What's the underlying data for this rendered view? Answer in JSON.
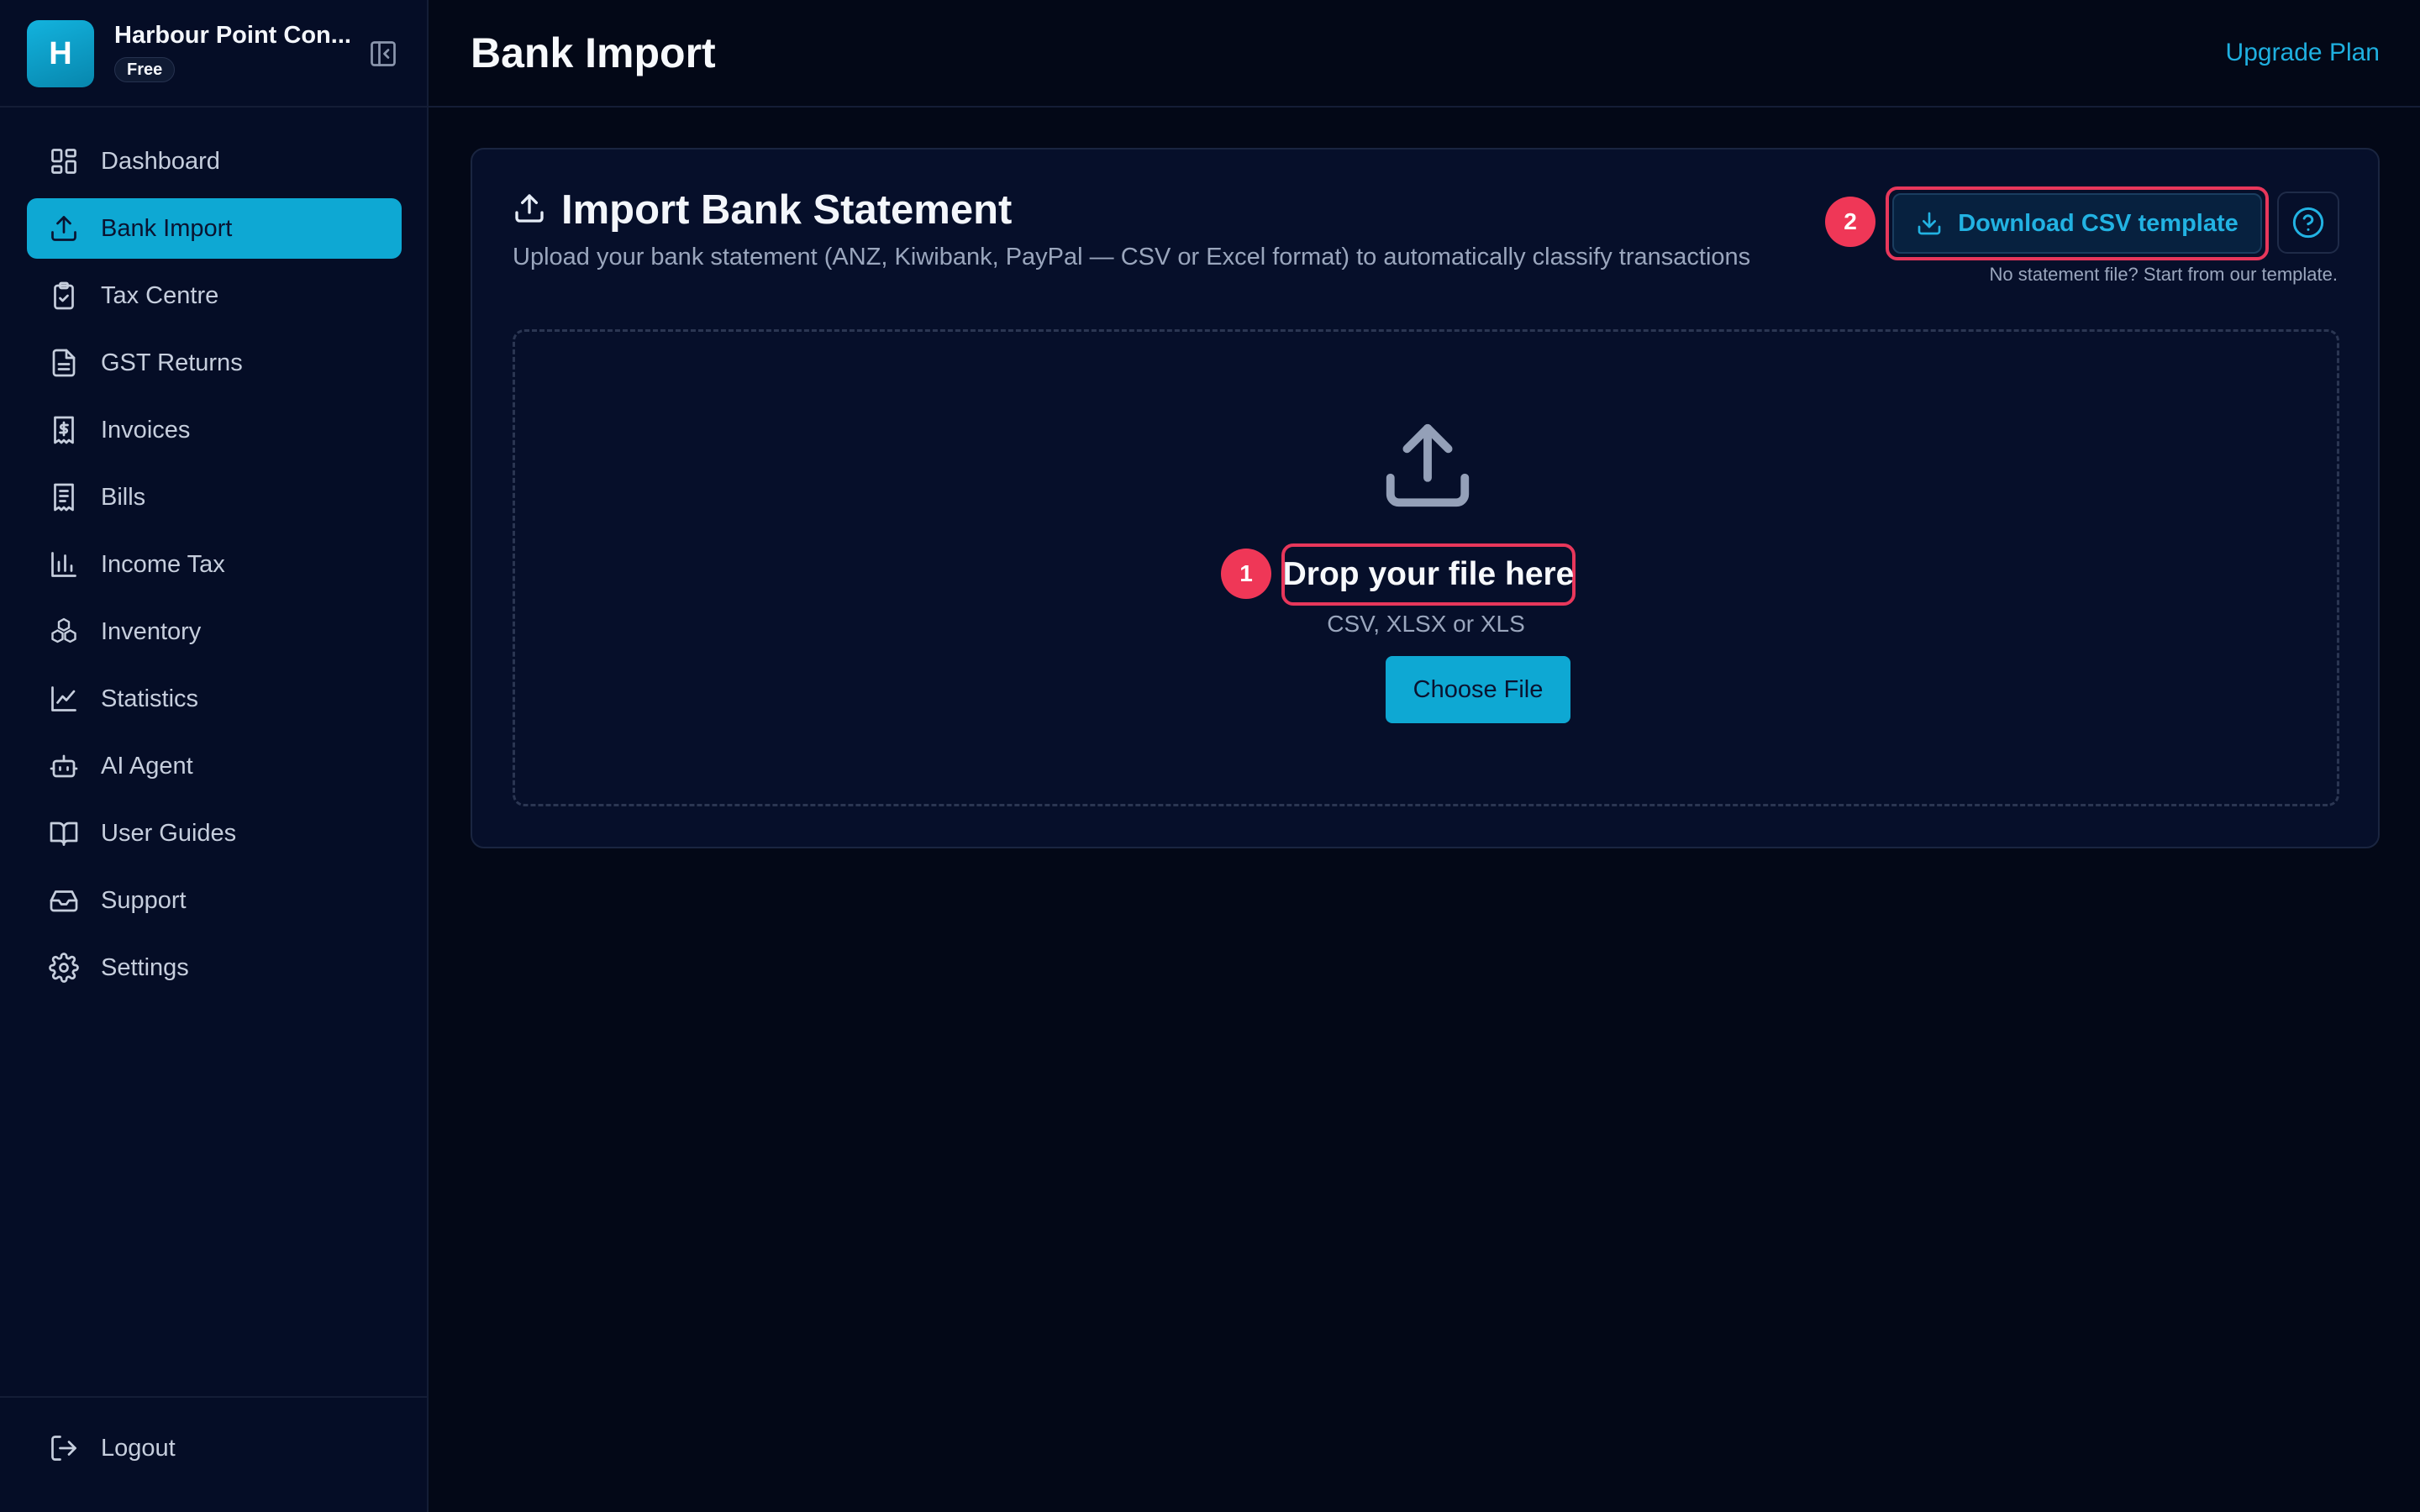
{
  "sidebar": {
    "org_initial": "H",
    "org_name": "Harbour Point Con...",
    "plan_badge": "Free",
    "items": [
      {
        "label": "Dashboard",
        "icon": "dashboard-icon",
        "active": false
      },
      {
        "label": "Bank Import",
        "icon": "upload-icon",
        "active": true
      },
      {
        "label": "Tax Centre",
        "icon": "clipboard-check-icon",
        "active": false
      },
      {
        "label": "GST Returns",
        "icon": "document-icon",
        "active": false
      },
      {
        "label": "Invoices",
        "icon": "receipt-dollar-icon",
        "active": false
      },
      {
        "label": "Bills",
        "icon": "receipt-icon",
        "active": false
      },
      {
        "label": "Income Tax",
        "icon": "bar-chart-icon",
        "active": false
      },
      {
        "label": "Inventory",
        "icon": "boxes-icon",
        "active": false
      },
      {
        "label": "Statistics",
        "icon": "line-chart-icon",
        "active": false
      },
      {
        "label": "AI Agent",
        "icon": "robot-icon",
        "active": false
      },
      {
        "label": "User Guides",
        "icon": "book-icon",
        "active": false
      },
      {
        "label": "Support",
        "icon": "inbox-icon",
        "active": false
      },
      {
        "label": "Settings",
        "icon": "gear-icon",
        "active": false
      }
    ],
    "logout_label": "Logout"
  },
  "header": {
    "title": "Bank Import",
    "upgrade_label": "Upgrade Plan"
  },
  "card": {
    "title": "Import Bank Statement",
    "subtitle": "Upload your bank statement (ANZ, Kiwibank, PayPal — CSV or Excel format) to automatically classify transactions",
    "download_label": "Download CSV template",
    "download_hint": "No statement file? Start from our template.",
    "step_badge_download": "2",
    "dropzone": {
      "title": "Drop your file here",
      "formats": "CSV, XLSX or XLS",
      "choose_label": "Choose File",
      "step_badge": "1"
    }
  },
  "colors": {
    "accent": "#0ea8d3",
    "highlight": "#e8375b",
    "background": "#030817",
    "sidebar": "#050d26"
  }
}
